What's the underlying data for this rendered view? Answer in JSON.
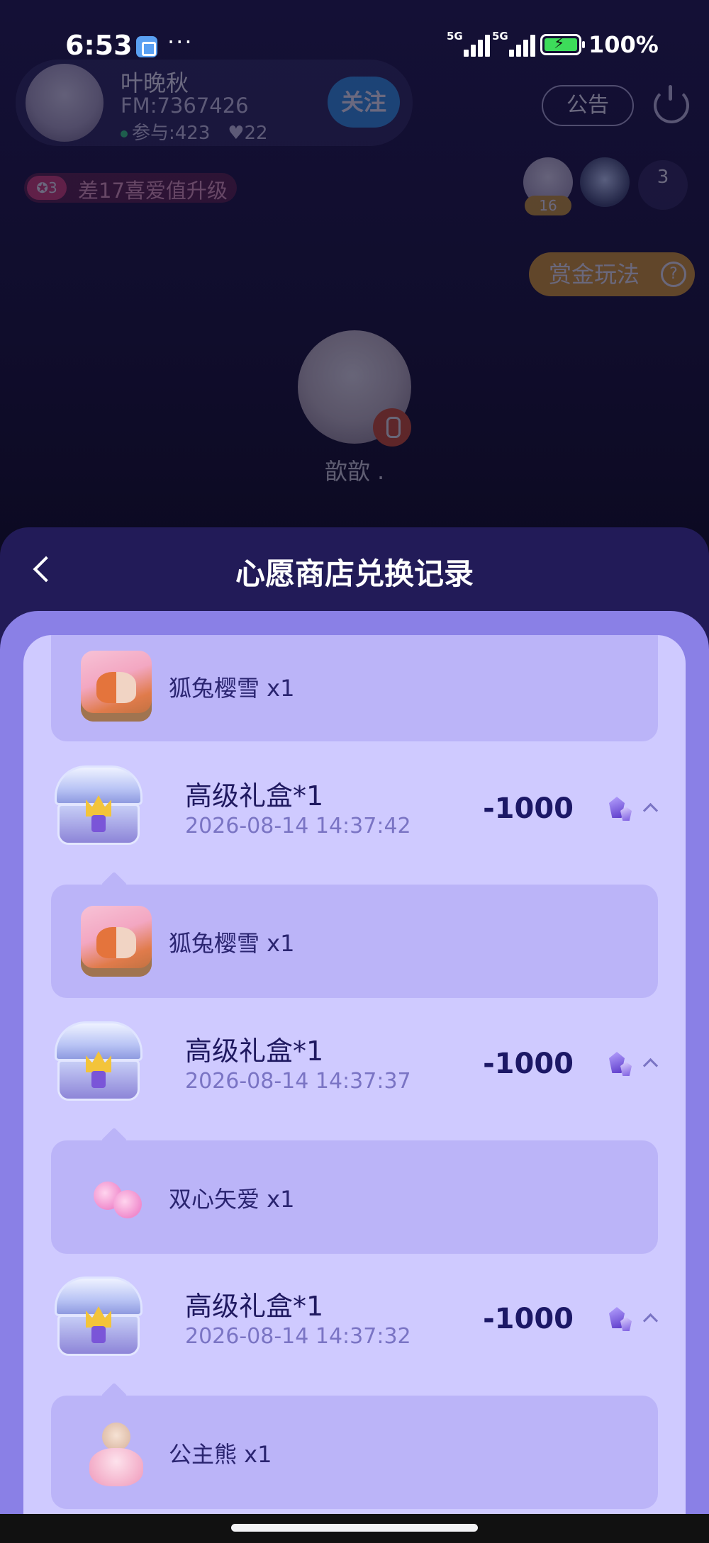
{
  "status_bar": {
    "time": "6:53",
    "more": "···",
    "signal_1": "5G",
    "signal_2": "5G",
    "battery": "100%"
  },
  "host": {
    "name": "叶晚秋",
    "fm_id": "FM:7367426",
    "participants": "参与:423",
    "likes": "♥22",
    "follow_label": "关注"
  },
  "notice_label": "公告",
  "level": {
    "badge": "✪3",
    "text": "差17喜爱值升级"
  },
  "viewers": {
    "badge": "16",
    "count": "3"
  },
  "bounty_label": "赏金玩法",
  "bounty_help": "?",
  "mic_user": "歆歆 .",
  "sheet": {
    "title": "心愿商店兑换记录"
  },
  "records_top_detail": {
    "gift": "狐兔樱雪 x1"
  },
  "records": [
    {
      "title": "高级礼盒*1",
      "time": "2026-08-14 14:37:42",
      "amount": "-1000",
      "gift": "狐兔樱雪 x1"
    },
    {
      "title": "高级礼盒*1",
      "time": "2026-08-14 14:37:37",
      "amount": "-1000",
      "gift": "双心矢爱 x1"
    },
    {
      "title": "高级礼盒*1",
      "time": "2026-08-14 14:37:32",
      "amount": "-1000",
      "gift": "公主熊 x1"
    }
  ],
  "colors": {
    "sheet_header": "#221b58",
    "frame": "#8a80e6",
    "panel": "#cfcaff",
    "detail_card": "#bbb4f8",
    "amount_text": "#1c1866"
  }
}
